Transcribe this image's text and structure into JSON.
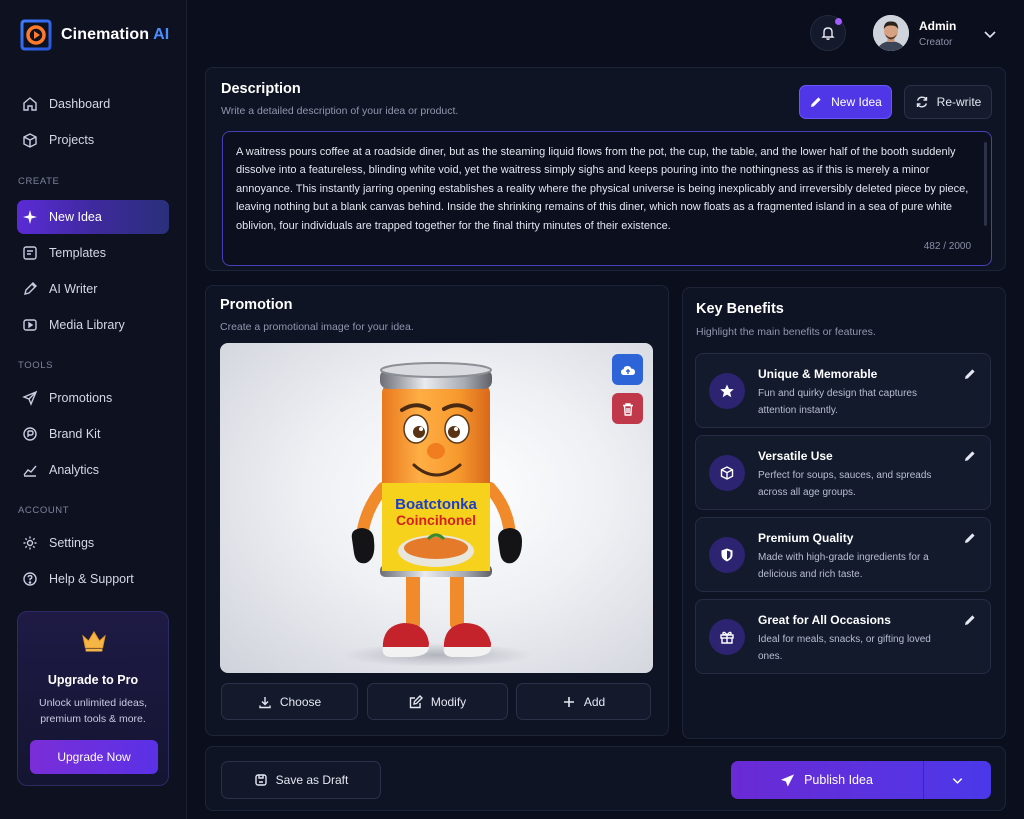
{
  "app": {
    "name_main": "Cinemation",
    "name_accent": "AI"
  },
  "sidebar": {
    "top_items": [
      {
        "label": "Dashboard",
        "icon": "home-icon"
      },
      {
        "label": "Projects",
        "icon": "box-icon"
      }
    ],
    "create_label": "CREATE",
    "create_items": [
      {
        "label": "New Idea",
        "icon": "sparkle-icon",
        "active": true
      },
      {
        "label": "Templates",
        "icon": "template-icon"
      },
      {
        "label": "AI Writer",
        "icon": "pen-icon"
      },
      {
        "label": "Media Library",
        "icon": "media-icon"
      }
    ],
    "tools_label": "TOOLS",
    "tools_items": [
      {
        "label": "Promotions",
        "icon": "send-icon"
      },
      {
        "label": "Brand Kit",
        "icon": "brand-icon"
      },
      {
        "label": "Analytics",
        "icon": "chart-icon"
      }
    ],
    "account_label": "ACCOUNT",
    "account_items": [
      {
        "label": "Settings",
        "icon": "gear-icon"
      },
      {
        "label": "Help & Support",
        "icon": "help-icon"
      }
    ],
    "upgrade": {
      "title": "Upgrade to Pro",
      "text": "Unlock unlimited ideas, premium tools & more.",
      "button": "Upgrade Now"
    }
  },
  "user": {
    "name": "Admin",
    "role": "Creator"
  },
  "description": {
    "title": "Description",
    "subtitle": "Write a detailed description of your idea or product.",
    "new_idea_button": "New Idea",
    "rewrite_button": "Re-write",
    "text": "A waitress pours coffee at a roadside diner, but as the steaming liquid flows from the pot, the cup, the table, and the lower half of the booth suddenly dissolve into a featureless, blinding white void, yet the waitress simply sighs and keeps pouring into the nothingness as if this is merely a minor annoyance. This instantly jarring opening establishes a reality where the physical universe is being inexplicably and irreversibly deleted piece by piece, leaving nothing but a blank canvas behind. Inside the shrinking remains of this diner, which now floats as a fragmented island in a sea of pure white oblivion, four individuals are trapped together for the final thirty minutes of their existence.",
    "counter": "482 / 2000"
  },
  "promotion": {
    "title": "Promotion",
    "subtitle": "Create a promotional image for your idea.",
    "can_label_line1": "Boatctonka",
    "can_label_line2": "Coincihonel",
    "choose_button": "Choose",
    "modify_button": "Modify",
    "add_button": "Add"
  },
  "benefits": {
    "title": "Key Benefits",
    "subtitle": "Highlight the main benefits or features.",
    "items": [
      {
        "title": "Unique & Memorable",
        "desc": "Fun and quirky design that captures attention instantly.",
        "icon": "star-icon"
      },
      {
        "title": "Versatile Use",
        "desc": "Perfect for soups, sauces, and spreads across all age groups.",
        "icon": "cube-icon"
      },
      {
        "title": "Premium Quality",
        "desc": "Made with high-grade ingredients for a delicious and rich taste.",
        "icon": "shield-icon"
      },
      {
        "title": "Great for All Occasions",
        "desc": "Ideal for meals, snacks, or gifting loved ones.",
        "icon": "gift-icon"
      }
    ]
  },
  "footer": {
    "save_draft": "Save as Draft",
    "publish": "Publish Idea"
  },
  "colors": {
    "accent": "#4f37e8",
    "background": "#0b0f1d",
    "danger": "#c0394a"
  }
}
